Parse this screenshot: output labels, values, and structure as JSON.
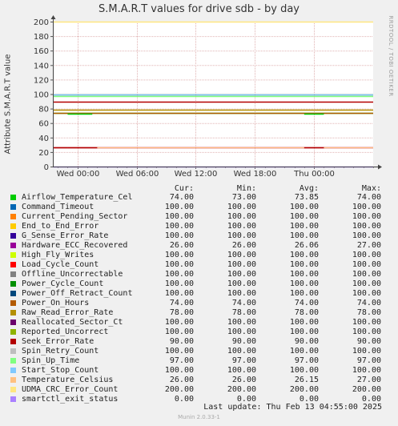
{
  "chart_data": {
    "type": "line",
    "title": "S.M.A.R.T values for drive sdb - by day",
    "ylabel": "Attribute S.M.A.R.T value",
    "ylim": [
      0,
      200
    ],
    "yticks": [
      0,
      20,
      40,
      60,
      80,
      100,
      120,
      140,
      160,
      180,
      200
    ],
    "xlim": [
      "Tue 21:30",
      "Thu 06:00"
    ],
    "xticks": [
      "Wed 00:00",
      "Wed 06:00",
      "Wed 12:00",
      "Wed 18:00",
      "Thu 00:00"
    ],
    "grid": true,
    "columns": [
      "Cur:",
      "Min:",
      "Avg:",
      "Max:"
    ],
    "series": [
      {
        "name": "Airflow_Temperature_Cel",
        "color": "#00cc00",
        "cur": "74.00",
        "min": "73.00",
        "avg": "73.85",
        "max": "74.00"
      },
      {
        "name": "Command_Timeout",
        "color": "#0066b3",
        "cur": "100.00",
        "min": "100.00",
        "avg": "100.00",
        "max": "100.00"
      },
      {
        "name": "Current_Pending_Sector",
        "color": "#ff8000",
        "cur": "100.00",
        "min": "100.00",
        "avg": "100.00",
        "max": "100.00"
      },
      {
        "name": "End_to_End_Error",
        "color": "#ffcc00",
        "cur": "100.00",
        "min": "100.00",
        "avg": "100.00",
        "max": "100.00"
      },
      {
        "name": "G_Sense_Error_Rate",
        "color": "#330099",
        "cur": "100.00",
        "min": "100.00",
        "avg": "100.00",
        "max": "100.00"
      },
      {
        "name": "Hardware_ECC_Recovered",
        "color": "#990099",
        "cur": "26.00",
        "min": "26.00",
        "avg": "26.06",
        "max": "27.00"
      },
      {
        "name": "High_Fly_Writes",
        "color": "#ccff00",
        "cur": "100.00",
        "min": "100.00",
        "avg": "100.00",
        "max": "100.00"
      },
      {
        "name": "Load_Cycle_Count",
        "color": "#ff0000",
        "cur": "100.00",
        "min": "100.00",
        "avg": "100.00",
        "max": "100.00"
      },
      {
        "name": "Offline_Uncorrectable",
        "color": "#808080",
        "cur": "100.00",
        "min": "100.00",
        "avg": "100.00",
        "max": "100.00"
      },
      {
        "name": "Power_Cycle_Count",
        "color": "#008f00",
        "cur": "100.00",
        "min": "100.00",
        "avg": "100.00",
        "max": "100.00"
      },
      {
        "name": "Power_Off_Retract_Count",
        "color": "#00487d",
        "cur": "100.00",
        "min": "100.00",
        "avg": "100.00",
        "max": "100.00"
      },
      {
        "name": "Power_On_Hours",
        "color": "#b35a00",
        "cur": "74.00",
        "min": "74.00",
        "avg": "74.00",
        "max": "74.00"
      },
      {
        "name": "Raw_Read_Error_Rate",
        "color": "#b38f00",
        "cur": "78.00",
        "min": "78.00",
        "avg": "78.00",
        "max": "78.00"
      },
      {
        "name": "Reallocated_Sector_Ct",
        "color": "#6b006b",
        "cur": "100.00",
        "min": "100.00",
        "avg": "100.00",
        "max": "100.00"
      },
      {
        "name": "Reported_Uncorrect",
        "color": "#8fb300",
        "cur": "100.00",
        "min": "100.00",
        "avg": "100.00",
        "max": "100.00"
      },
      {
        "name": "Seek_Error_Rate",
        "color": "#b30000",
        "cur": "90.00",
        "min": "90.00",
        "avg": "90.00",
        "max": "90.00"
      },
      {
        "name": "Spin_Retry_Count",
        "color": "#bebebe",
        "cur": "100.00",
        "min": "100.00",
        "avg": "100.00",
        "max": "100.00"
      },
      {
        "name": "Spin_Up_Time",
        "color": "#80ff80",
        "cur": "97.00",
        "min": "97.00",
        "avg": "97.00",
        "max": "97.00"
      },
      {
        "name": "Start_Stop_Count",
        "color": "#80c9ff",
        "cur": "100.00",
        "min": "100.00",
        "avg": "100.00",
        "max": "100.00"
      },
      {
        "name": "Temperature_Celsius",
        "color": "#ffc080",
        "cur": "26.00",
        "min": "26.00",
        "avg": "26.15",
        "max": "27.00"
      },
      {
        "name": "UDMA_CRC_Error_Count",
        "color": "#ffe680",
        "cur": "200.00",
        "min": "200.00",
        "avg": "200.00",
        "max": "200.00"
      },
      {
        "name": "smartctl_exit_status",
        "color": "#aa80ff",
        "cur": "0.00",
        "min": "0.00",
        "avg": "0.00",
        "max": "0.00"
      }
    ],
    "segments": [
      {
        "series": 5,
        "value": 27,
        "from": "Tue 21:30",
        "to": "Tue 23:00"
      },
      {
        "series": 5,
        "value": 26,
        "from": "Tue 23:00",
        "to": "Thu 06:00"
      },
      {
        "series": 19,
        "value": 26,
        "from": "Tue 21:30",
        "to": "Thu 06:00"
      },
      {
        "series": 15,
        "value": 27,
        "from": "Tue 21:30",
        "to": "Tue 23:00"
      },
      {
        "series": 15,
        "value": 26,
        "from": "Tue 23:00",
        "to": "Wed 02:00"
      },
      {
        "series": 15,
        "value": 26,
        "from": "Wed 23:00",
        "to": "Thu 01:00"
      },
      {
        "series": 0,
        "value": 73,
        "from": "Tue 23:00",
        "to": "Wed 01:30"
      },
      {
        "series": 0,
        "value": 73,
        "from": "Wed 23:00",
        "to": "Thu 01:00"
      }
    ]
  },
  "side_text": "RRDTOOL / TOBI OETIKER",
  "last_update_label": "Last update:",
  "last_update_value": "Thu Feb 13 04:55:00 2025",
  "footer": "Munin 2.0.33-1"
}
